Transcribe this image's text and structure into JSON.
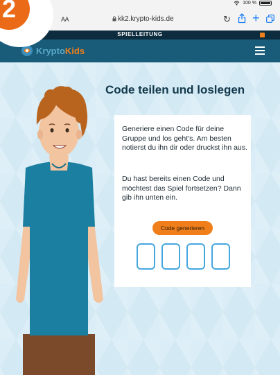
{
  "status_bar": {
    "battery_text": "100 %"
  },
  "browser": {
    "aa_label": "AA",
    "url": "kk2.krypto-kids.de"
  },
  "game_header": {
    "label": "SPIELLEITUNG"
  },
  "app_nav": {
    "logo_part1": "Krypto",
    "logo_part2": "Kids"
  },
  "main": {
    "title": "Code teilen und loslegen",
    "paragraph1": "Generiere einen Code für deine Gruppe und los geht's. Am besten notierst du ihn dir oder druckst ihn aus.",
    "paragraph2": "Du hast bereits einen Code und möchtest das Spiel fortsetzen? Dann gib ihn unten ein.",
    "generate_button": "Code generieren",
    "code_inputs": [
      "",
      "",
      "",
      ""
    ]
  },
  "step_badge": {
    "number": "2"
  },
  "colors": {
    "header_dark": "#0d2d3e",
    "nav_blue": "#195c79",
    "accent_orange": "#f07f1b",
    "input_border": "#46a6de",
    "background": "#d3e9f4"
  }
}
